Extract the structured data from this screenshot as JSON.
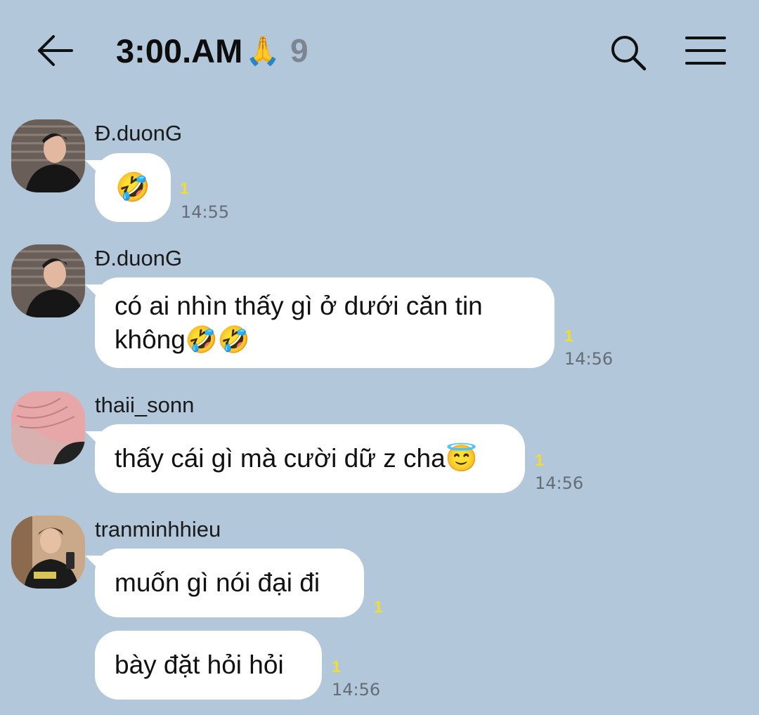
{
  "header": {
    "title": "3:00.AM",
    "title_emoji": "🙏",
    "member_count": "9",
    "icons": [
      "back-arrow-icon",
      "search-icon",
      "menu-icon"
    ]
  },
  "messages": [
    {
      "sender": "Đ.duonG",
      "text": "🤣",
      "unread": "1",
      "time": "14:55"
    },
    {
      "sender": "Đ.duonG",
      "line1": "có ai nhìn thấy gì ở dưới căn tin",
      "line2": "không🤣🤣",
      "unread": "1",
      "time": "14:56"
    },
    {
      "sender": "thaii_sonn",
      "text": "thấy cái gì mà cười dữ z cha😇",
      "unread": "1",
      "time": "14:56"
    },
    {
      "sender": "tranminhhieu",
      "text": "muốn gì nói đại đi",
      "unread": "1"
    },
    {
      "text": "bày đặt hỏi hỏi",
      "unread": "1",
      "time": "14:56"
    }
  ],
  "colors": {
    "background": "#b2c7da",
    "bubble": "#ffffff",
    "unread": "#f1dd2c",
    "time": "#656e78",
    "count": "#7c8690"
  }
}
